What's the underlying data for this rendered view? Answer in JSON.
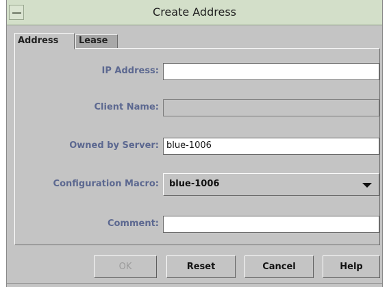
{
  "window": {
    "title": "Create Address",
    "menu_icon": "window-menu-icon"
  },
  "tabs": [
    {
      "label": "Address",
      "active": true
    },
    {
      "label": "Lease",
      "active": false
    }
  ],
  "form": {
    "ip_address": {
      "label": "IP Address:",
      "value": ""
    },
    "client_name": {
      "label": "Client Name:",
      "value": ""
    },
    "owned_by_server": {
      "label": "Owned by Server:",
      "value": "blue-1006"
    },
    "configuration_macro": {
      "label": "Configuration Macro:",
      "value": "blue-1006"
    },
    "comment": {
      "label": "Comment:",
      "value": ""
    }
  },
  "buttons": {
    "ok": "OK",
    "reset": "Reset",
    "cancel": "Cancel",
    "help": "Help"
  },
  "colors": {
    "titlebar": "#d3dfc9",
    "dialog_bg": "#c4c4c4",
    "label_text": "#5c6890"
  }
}
